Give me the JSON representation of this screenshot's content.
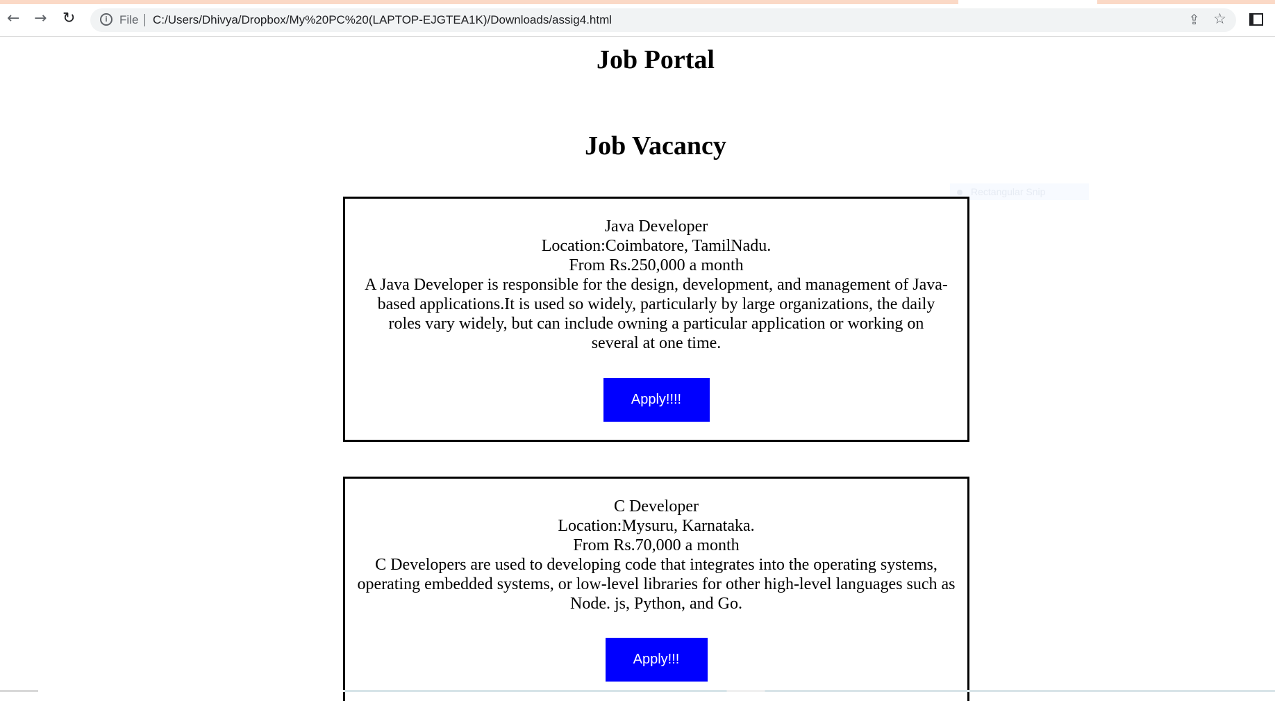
{
  "browser": {
    "file_label": "File",
    "url": "C:/Users/Dhivya/Dropbox/My%20PC%20(LAPTOP-EJGTEA1K)/Downloads/assig4.html"
  },
  "page": {
    "title": "Job Portal",
    "subtitle": "Job Vacancy"
  },
  "jobs": [
    {
      "title": "Java Developer",
      "location": "Location:Coimbatore, TamilNadu.",
      "salary": "From Rs.250,000 a month",
      "description": "A Java Developer is responsible for the design, development, and management of Java-based applications.It is used so widely, particularly by large organizations, the daily roles vary widely, but can include owning a particular application or working on several at one time.",
      "apply_label": "Apply!!!!"
    },
    {
      "title": "C Developer",
      "location": "Location:Mysuru, Karnataka.",
      "salary": "From Rs.70,000 a month",
      "description": "C Developers are used to developing code that integrates into the operating systems, operating embedded systems, or low-level libraries for other high-level languages such as Node. js, Python, and Go.",
      "apply_label": "Apply!!!"
    }
  ],
  "overlay": {
    "snip_label": "Rectangular Snip"
  },
  "colors": {
    "button": "#0000ff",
    "button_text": "#ffffff"
  }
}
